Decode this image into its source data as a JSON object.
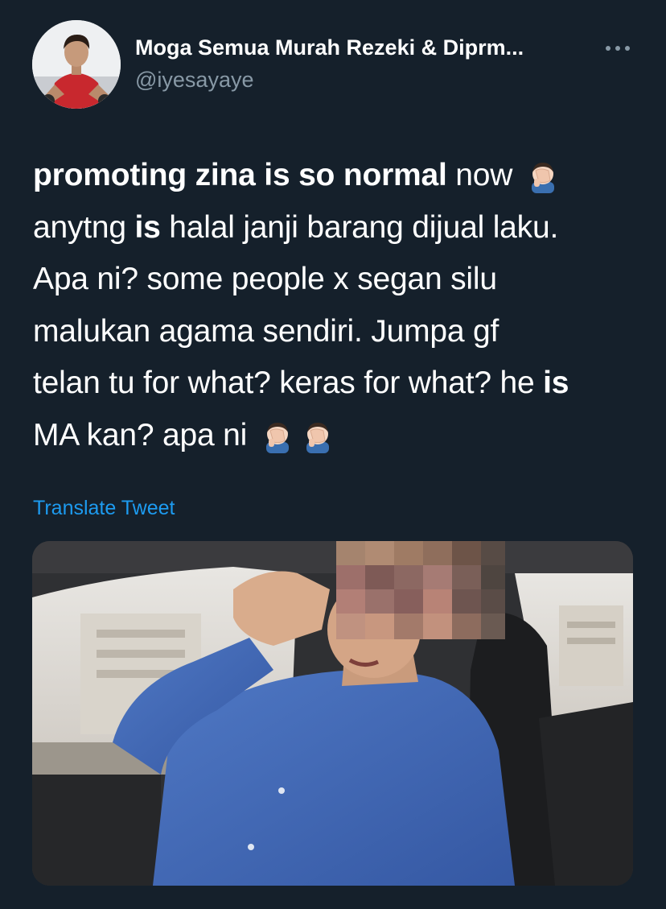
{
  "user": {
    "display_name": "Moga Semua Murah Rezeki & Diprm...",
    "handle": "@iyesayaye",
    "avatar_icon": "profile-photo"
  },
  "menu": {
    "more_icon": "more-dots-icon"
  },
  "tweet": {
    "line1_bold": "promoting zina is so normal",
    "line1_rest": " now",
    "line2_a": "anytng ",
    "line2_bold": "is",
    "line2_b": " halal janji barang dijual laku.",
    "line3": "Apa ni? some people x segan silu",
    "line4": "malukan agama sendiri. Jumpa gf",
    "line5_a": "telan tu for what? keras for what? he ",
    "line5_bold": "is",
    "line6": "MA kan? apa ni",
    "emoji_icon": "man-facepalming-emoji"
  },
  "translate": {
    "label": "Translate Tweet"
  },
  "media": {
    "kind": "video-still",
    "icon": "pixelated-face-photo"
  },
  "colors": {
    "background": "#15202b",
    "text": "#ffffff",
    "secondary": "#8899a6",
    "link": "#1d9bf0"
  }
}
